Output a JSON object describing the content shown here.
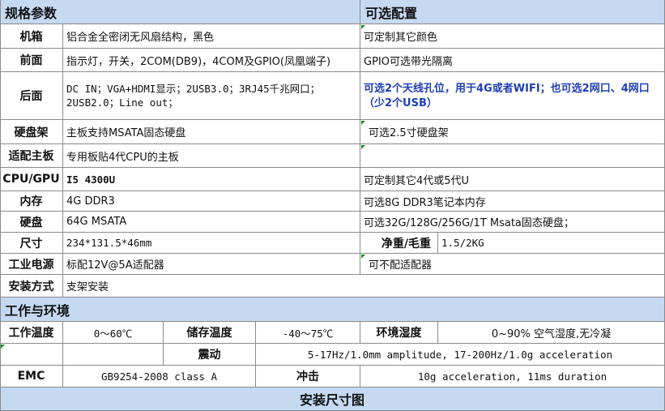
{
  "spec": {
    "title": "规格参数",
    "options_title": "可选配置",
    "rows": [
      {
        "label": "机箱",
        "value": "铝合金全密闭无风扇结构，黑色",
        "option": "可定制其它颜色"
      },
      {
        "label": "前面",
        "value": "指示灯，开关，2COM(DB9)，4COM及GPIO(凤凰端子)",
        "option": "GPIO可选带光隔离"
      },
      {
        "label": "后面",
        "value": "DC IN；VGA+HDMI显示；2USB3.0；3RJ45千兆网口；2USB2.0；Line out；",
        "option": "可选2个天线孔位，用于4G或者WIFI；也可选2网口、4网口（少2个USB）"
      },
      {
        "label": "硬盘架",
        "value": "主板支持MSATA固态硬盘",
        "option": "可选2.5寸硬盘架"
      },
      {
        "label": "适配主板",
        "value": "专用板贴4代CPU的主板",
        "option": ""
      },
      {
        "label": "CPU/GPU",
        "value": "I5 4300U",
        "option": "可定制其它4代或5代U"
      },
      {
        "label": "内存",
        "value": "4G DDR3",
        "option": "可选8G DDR3笔记本内存"
      },
      {
        "label": "硬盘",
        "value": "64G MSATA",
        "option": "可选32G/128G/256G/1T Msata固态硬盘；"
      },
      {
        "label": "尺寸",
        "value": "234*131.5*46mm",
        "weight_label": "净重/毛重",
        "weight_value": "1.5/2KG"
      },
      {
        "label": "工业电源",
        "value": "标配12V@5A适配器",
        "option": "可不配适配器"
      },
      {
        "label": "安装方式",
        "value": "支架安装"
      }
    ]
  },
  "env": {
    "title": "工作与环境",
    "op_temp_label": "工作温度",
    "op_temp_value": "0～60℃",
    "storage_temp_label": "储存温度",
    "storage_temp_value": "-40～75℃",
    "humidity_label": "环境湿度",
    "humidity_value": "0~90% 空气湿度,无冷凝",
    "vibration_label": "震动",
    "vibration_value": "5-17Hz/1.0mm amplitude, 17-200Hz/1.0g acceleration",
    "emc_label": "EMC",
    "emc_value": "GB9254-2008 class A",
    "shock_label": "冲击",
    "shock_value": "10g acceleration, 11ms duration"
  },
  "install": {
    "title": "安装尺寸图"
  },
  "colors": {
    "header_bg": "#c5d9f1",
    "highlight_text": "#1f3fb3",
    "grid_line": "#8a8a8a",
    "comment_marker": "#1a8c1a"
  }
}
